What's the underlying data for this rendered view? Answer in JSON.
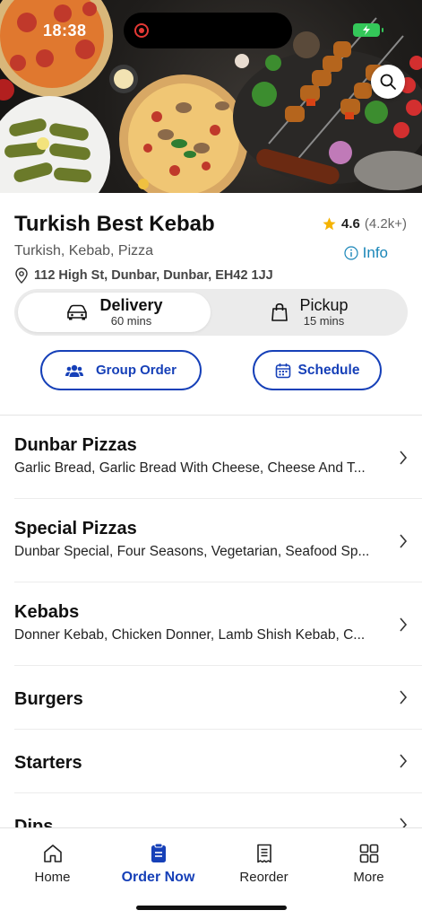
{
  "status_bar": {
    "time": "18:38"
  },
  "restaurant": {
    "name": "Turkish Best Kebab",
    "rating": "4.6",
    "rating_count": "(4.2k+)",
    "cuisines": "Turkish, Kebab, Pizza",
    "info_label": "Info",
    "address": "112 High St, Dunbar, Dunbar, EH42 1JJ"
  },
  "fulfilment": {
    "delivery": {
      "label": "Delivery",
      "time": "60 mins"
    },
    "pickup": {
      "label": "Pickup",
      "time": "15 mins"
    }
  },
  "actions": {
    "group_order": "Group Order",
    "schedule": "Schedule"
  },
  "categories": [
    {
      "title": "Dunbar Pizzas",
      "desc": "Garlic Bread, Garlic Bread With Cheese, Cheese And T..."
    },
    {
      "title": "Special Pizzas",
      "desc": "Dunbar Special, Four Seasons, Vegetarian, Seafood Sp..."
    },
    {
      "title": "Kebabs",
      "desc": "Donner Kebab, Chicken Donner, Lamb Shish Kebab, C..."
    },
    {
      "title": "Burgers"
    },
    {
      "title": "Starters"
    },
    {
      "title": "Dips"
    }
  ],
  "tabs": [
    {
      "label": "Home",
      "icon": "home-icon"
    },
    {
      "label": "Order Now",
      "icon": "order-bag-icon"
    },
    {
      "label": "Reorder",
      "icon": "receipt-icon"
    },
    {
      "label": "More",
      "icon": "grid-icon"
    }
  ],
  "colors": {
    "accent": "#1640b8",
    "info": "#1a86b8",
    "star": "#f5b301"
  }
}
